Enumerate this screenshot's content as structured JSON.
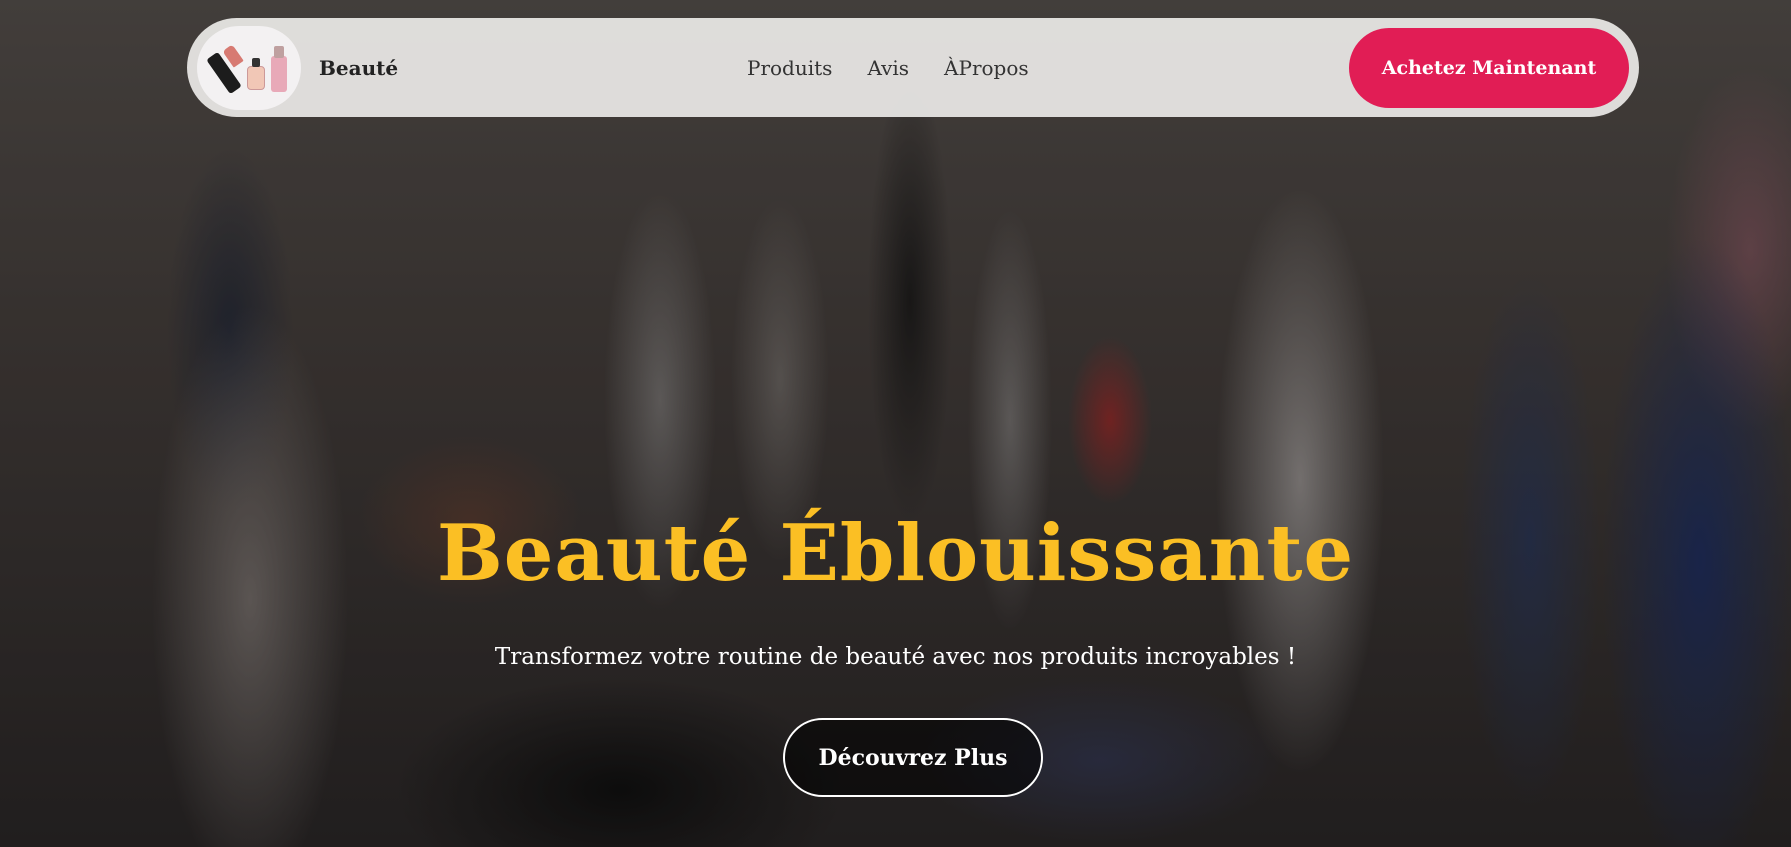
{
  "nav": {
    "brand": "Beauté",
    "logo_icon": "cosmetics-logo",
    "links": [
      {
        "label": "Produits"
      },
      {
        "label": "Avis"
      },
      {
        "label": "ÀPropos"
      }
    ],
    "cta_label": "Achetez Maintenant"
  },
  "hero": {
    "title": "Beauté Éblouissante",
    "subtitle": "Transformez votre routine de beauté avec nos produits incroyables !",
    "cta_label": "Découvrez Plus"
  },
  "colors": {
    "accent": "#e11d55",
    "title": "#fbbf24",
    "nav_bg": "#f0eeec"
  }
}
